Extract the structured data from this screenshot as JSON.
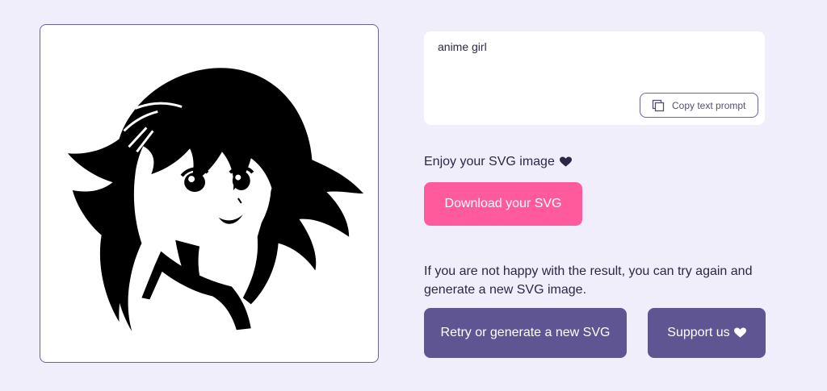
{
  "preview": {
    "image_alt_icon": "anime-girl-illustration"
  },
  "prompt": {
    "text": "anime girl",
    "copy_label": "Copy text prompt",
    "copy_icon": "copy-icon"
  },
  "result": {
    "enjoy_text": "Enjoy your SVG image",
    "heart_icon": "heart-icon",
    "download_label": "Download your SVG",
    "retry_info": "If you are not happy with the result, you can try again and generate a new SVG image.",
    "retry_label": "Retry or generate a new SVG",
    "support_label": "Support us"
  },
  "colors": {
    "background": "#efeefa",
    "primary_pink": "#ff5a9b",
    "primary_purple": "#5e5592",
    "border": "#6a6298",
    "text": "#2b2745"
  }
}
